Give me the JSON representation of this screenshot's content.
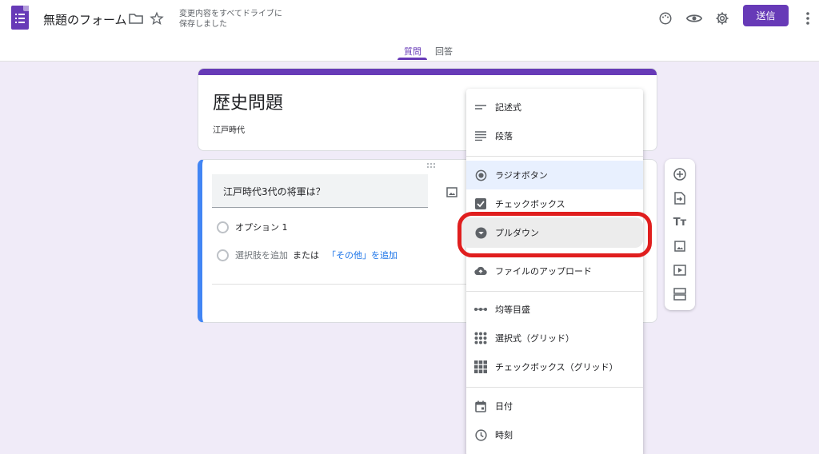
{
  "header": {
    "doc_title": "無題のフォーム",
    "save_status": "変更内容をすべてドライブに保存しました",
    "send_label": "送信",
    "tabs": [
      {
        "label": "質問",
        "active": true
      },
      {
        "label": "回答",
        "active": false
      }
    ],
    "accent_color": "#673ab7"
  },
  "form": {
    "title": "歴史問題",
    "description": "江戸時代"
  },
  "question": {
    "text": "江戸時代3代の将軍は？",
    "options": [
      "オプション 1"
    ],
    "add_option": "選択肢を追加",
    "or": "または",
    "add_other": "「その他」を追加"
  },
  "menu": {
    "items": [
      {
        "label": "記述式",
        "icon": "short-text-icon"
      },
      {
        "label": "段落",
        "icon": "paragraph-icon"
      },
      {
        "label": "ラジオボタン",
        "icon": "radio-button-icon",
        "selected": true
      },
      {
        "label": "チェックボックス",
        "icon": "checkbox-icon"
      },
      {
        "label": "プルダウン",
        "icon": "dropdown-icon",
        "highlighted": true
      },
      {
        "label": "ファイルのアップロード",
        "icon": "cloud-upload-icon"
      },
      {
        "label": "均等目盛",
        "icon": "linear-scale-icon"
      },
      {
        "label": "選択式（グリッド）",
        "icon": "grid-dots-icon"
      },
      {
        "label": "チェックボックス（グリッド）",
        "icon": "grid-squares-icon"
      },
      {
        "label": "日付",
        "icon": "calendar-icon"
      },
      {
        "label": "時刻",
        "icon": "clock-icon"
      }
    ]
  },
  "highlight_color": "#e01e1e"
}
